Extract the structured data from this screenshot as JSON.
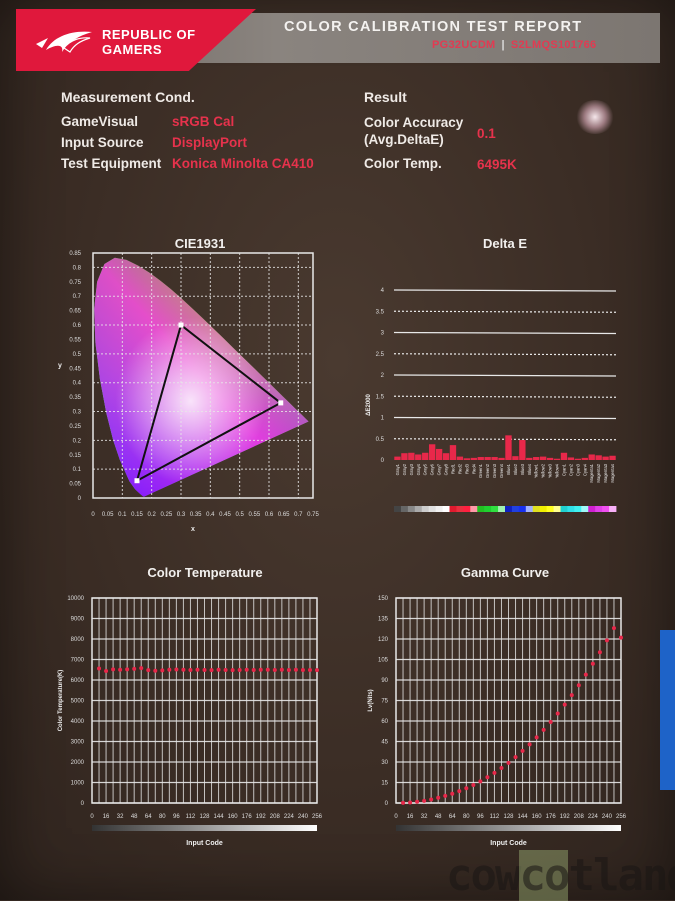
{
  "header": {
    "brand_line1": "REPUBLIC OF",
    "brand_line2": "GAMERS",
    "logo_icon": "rog-eye-logo-icon",
    "title": "COLOR CALIBRATION TEST REPORT",
    "model": "PG32UCDM",
    "serial": "S2LMQS101766",
    "separator": "|"
  },
  "measurement": {
    "heading": "Measurement Cond.",
    "rows": [
      {
        "label": "GameVisual",
        "value": "sRGB Cal"
      },
      {
        "label": "Input Source",
        "value": "DisplayPort"
      },
      {
        "label": "Test Equipment",
        "value": "Konica Minolta CA410"
      }
    ]
  },
  "result": {
    "heading": "Result",
    "rows": [
      {
        "label_line1": "Color Accuracy",
        "label_line2": "(Avg.DeltaE)",
        "value": "0.1"
      },
      {
        "label_line1": "Color Temp.",
        "label_line2": "",
        "value": "6495K"
      }
    ]
  },
  "colors": {
    "accent_red": "#e0183c",
    "data_red": "#e8284a",
    "grid": "#e8e8e8"
  },
  "chart_data": [
    {
      "type": "scatter",
      "title": "CIE1931",
      "xlabel": "x",
      "ylabel": "y",
      "xlim": [
        0,
        0.75
      ],
      "ylim": [
        0,
        0.85
      ],
      "xticks": [
        "0",
        "0.05",
        "0.1",
        "0.15",
        "0.2",
        "0.25",
        "0.3",
        "0.35",
        "0.4",
        "0.45",
        "0.5",
        "0.55",
        "0.6",
        "0.65",
        "0.7",
        "0.75"
      ],
      "yticks": [
        "0",
        "0.05",
        "0.1",
        "0.15",
        "0.2",
        "0.25",
        "0.3",
        "0.35",
        "0.4",
        "0.45",
        "0.5",
        "0.55",
        "0.6",
        "0.65",
        "0.7",
        "0.75",
        "0.8",
        "0.85"
      ],
      "grid": true,
      "gamut_triangle": [
        {
          "name": "Red",
          "x": 0.64,
          "y": 0.33
        },
        {
          "name": "Green",
          "x": 0.3,
          "y": 0.6
        },
        {
          "name": "Blue",
          "x": 0.15,
          "y": 0.06
        }
      ]
    },
    {
      "type": "bar",
      "title": "Delta E",
      "ylabel": "ΔE2000",
      "ylim": [
        0,
        4
      ],
      "yticks": [
        "0",
        "0.5",
        "1",
        "1.5",
        "2",
        "2.5",
        "3",
        "3.5",
        "4"
      ],
      "grid": true,
      "categories": [
        "Gray1",
        "Gray2",
        "Gray3",
        "Gray4",
        "Gray5",
        "Gray6",
        "Gray7",
        "Gray8",
        "Red1",
        "Red2",
        "Red3",
        "Red4",
        "Green1",
        "Green2",
        "Green3",
        "Green4",
        "Blue1",
        "Blue2",
        "Blue3",
        "Blue4",
        "Yellow1",
        "Yellow2",
        "Yellow3",
        "Yellow4",
        "Cyan1",
        "Cyan2",
        "Cyan3",
        "Cyan4",
        "Magenta1",
        "Magenta2",
        "Magenta3",
        "Magenta4"
      ],
      "values": [
        0.08,
        0.16,
        0.17,
        0.13,
        0.17,
        0.37,
        0.26,
        0.16,
        0.35,
        0.08,
        0.04,
        0.05,
        0.07,
        0.07,
        0.07,
        0.05,
        0.58,
        0.09,
        0.47,
        0.05,
        0.07,
        0.08,
        0.05,
        0.03,
        0.17,
        0.06,
        0.03,
        0.05,
        0.13,
        0.11,
        0.08,
        0.1
      ],
      "swatches": [
        "#444444",
        "#666666",
        "#888888",
        "#aaaaaa",
        "#cccccc",
        "#e0e0e0",
        "#f0f0f0",
        "#ffffff",
        "#e01a2e",
        "#e83040",
        "#ff2040",
        "#ff9aa8",
        "#22c022",
        "#20d030",
        "#30e040",
        "#a0f0b0",
        "#1020c0",
        "#2040e0",
        "#1830f0",
        "#a0b0ff",
        "#e0e020",
        "#f0f000",
        "#ffff20",
        "#ffff90",
        "#20d0d0",
        "#30e0e8",
        "#40f0f0",
        "#a0f8f8",
        "#d020d0",
        "#e040e8",
        "#f050f0",
        "#f8b0f8"
      ]
    },
    {
      "type": "line",
      "title": "Color Temperature",
      "xlabel": "Input Code",
      "ylabel": "Color Temperature(K)",
      "xlim": [
        0,
        256
      ],
      "ylim": [
        0,
        10000
      ],
      "xticks": [
        "0",
        "16",
        "32",
        "48",
        "64",
        "80",
        "96",
        "112",
        "128",
        "144",
        "160",
        "176",
        "192",
        "208",
        "224",
        "240",
        "256"
      ],
      "yticks": [
        "0",
        "1000",
        "2000",
        "3000",
        "4000",
        "5000",
        "6000",
        "7000",
        "8000",
        "9000",
        "10000"
      ],
      "grid": true,
      "x": [
        8,
        16,
        24,
        32,
        40,
        48,
        56,
        64,
        72,
        80,
        88,
        96,
        104,
        112,
        120,
        128,
        136,
        144,
        152,
        160,
        168,
        176,
        184,
        192,
        200,
        208,
        216,
        224,
        232,
        240,
        248,
        256
      ],
      "values": [
        6560,
        6440,
        6520,
        6500,
        6520,
        6540,
        6580,
        6480,
        6450,
        6470,
        6500,
        6510,
        6500,
        6490,
        6500,
        6490,
        6480,
        6500,
        6490,
        6480,
        6490,
        6500,
        6490,
        6500,
        6500,
        6490,
        6500,
        6490,
        6500,
        6490,
        6490,
        6480
      ]
    },
    {
      "type": "line",
      "title": "Gamma Curve",
      "xlabel": "Input Code",
      "ylabel": "Lv(Nits)",
      "xlim": [
        0,
        256
      ],
      "ylim": [
        0,
        150
      ],
      "xticks": [
        "0",
        "16",
        "32",
        "48",
        "64",
        "80",
        "96",
        "112",
        "128",
        "144",
        "160",
        "176",
        "192",
        "208",
        "224",
        "240",
        "256"
      ],
      "yticks": [
        "0",
        "15",
        "30",
        "45",
        "60",
        "75",
        "90",
        "105",
        "120",
        "135",
        "150"
      ],
      "grid": true,
      "x": [
        8,
        16,
        24,
        32,
        40,
        48,
        56,
        64,
        72,
        80,
        88,
        96,
        104,
        112,
        120,
        128,
        136,
        144,
        152,
        160,
        168,
        176,
        184,
        192,
        200,
        208,
        216,
        224,
        232,
        240,
        248,
        256
      ],
      "values": [
        0.1,
        0.4,
        0.9,
        1.6,
        2.6,
        3.8,
        5.2,
        6.8,
        8.7,
        10.8,
        13.2,
        15.8,
        18.8,
        22.0,
        25.6,
        29.4,
        33.6,
        38.1,
        42.9,
        48.0,
        53.5,
        59.3,
        65.5,
        72.0,
        78.9,
        86.2,
        93.9,
        101.9,
        110.3,
        119.0,
        128.0,
        121.0
      ]
    }
  ]
}
